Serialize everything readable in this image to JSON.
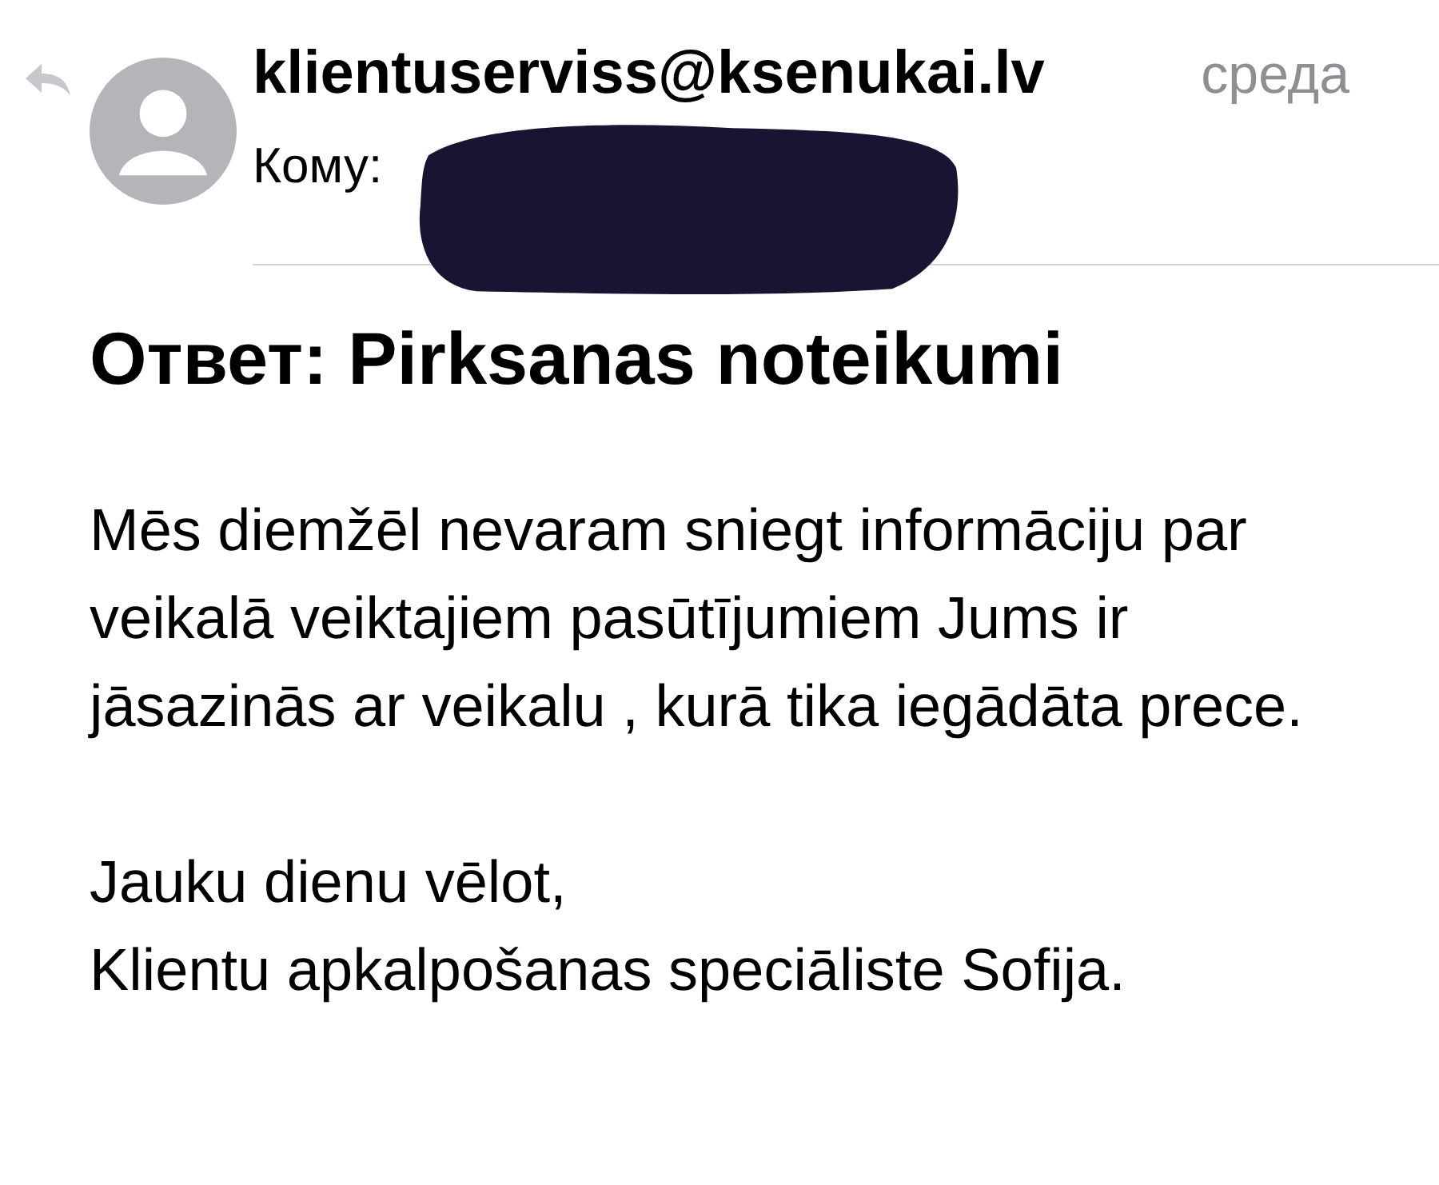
{
  "header": {
    "sender": "klientuserviss@ksenukai.lv",
    "date": "среда",
    "to_label": "Кому:"
  },
  "redaction": {
    "kind": "scribble"
  },
  "subject": "Ответ: Pirksanas noteikumi",
  "body": [
    "Mēs diemžēl nevaram sniegt informāciju par veikalā veiktajiem pasūtījumiem Jums ir jāsazinās ar veikalu , kurā tika iegādāta prece.",
    "Jauku dienu vēlot,\nKlientu apkalpošanas speciāliste Sofija."
  ]
}
